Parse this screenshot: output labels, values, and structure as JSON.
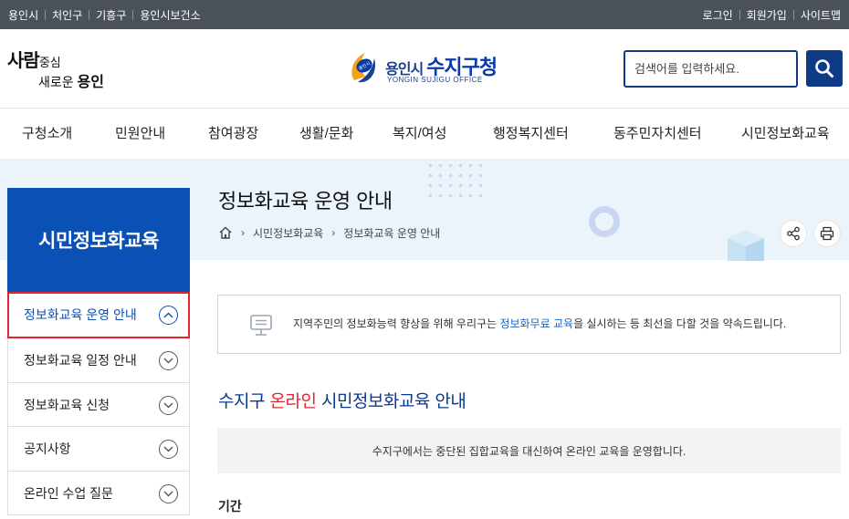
{
  "topbar": {
    "left_links": [
      "용인시",
      "처인구",
      "기흥구",
      "용인시보건소"
    ],
    "right_links": [
      "로그인",
      "회원가입",
      "사이트맵"
    ]
  },
  "header": {
    "slogan_line1_big": "사람",
    "slogan_line1_small": "중심",
    "slogan_line2_small": "새로운",
    "slogan_line2_big": "용인",
    "logo_city": "용인시",
    "logo_office": "수지구청",
    "logo_en": "YONGIN SUJIGU OFFICE",
    "emblem_text": "용인시",
    "search_placeholder": "검색어를 입력하세요."
  },
  "nav": {
    "items": [
      "구청소개",
      "민원안내",
      "참여광장",
      "생활/문화",
      "복지/여성",
      "행정복지센터",
      "동주민자치센터",
      "시민정보화교육"
    ]
  },
  "sidebar": {
    "title": "시민정보화교육",
    "items": [
      {
        "label": "정보화교육 운영 안내",
        "active": true
      },
      {
        "label": "정보화교육 일정 안내",
        "active": false
      },
      {
        "label": "정보화교육 신청",
        "active": false
      },
      {
        "label": "공지사항",
        "active": false
      },
      {
        "label": "온라인 수업 질문",
        "active": false
      }
    ]
  },
  "content": {
    "title": "정보화교육 운영 안내",
    "breadcrumb": [
      "시민정보화교육",
      "정보화교육 운영 안내"
    ],
    "notice_before": "지역주민의 정보화능력 향상을 위해 우리구는 ",
    "notice_highlight": "정보화무료 교육",
    "notice_after": "을 실시하는 등 최선을 다할 것을 약속드립니다.",
    "section_title_before": "수지구 ",
    "section_title_red": "온라인",
    "section_title_after": " 시민정보화교육 안내",
    "graybox_text": "수지구에서는 중단된 집합교육을 대신하여 온라인 교육을 운영합니다.",
    "subheading": "기간"
  },
  "colors": {
    "primary": "#0b50b5",
    "navy": "#0f3b86",
    "accent_red": "#e3262d",
    "topbar": "#4b5158",
    "band": "#ebf3fb"
  }
}
